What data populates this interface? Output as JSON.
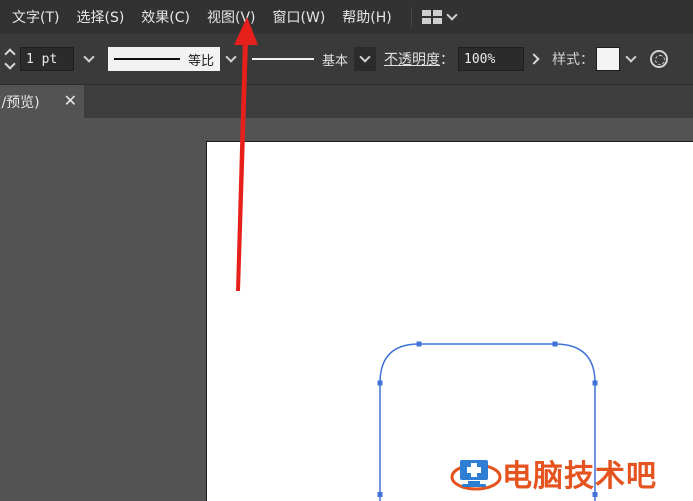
{
  "menubar": {
    "items": [
      {
        "label": "文字(T)"
      },
      {
        "label": "选择(S)"
      },
      {
        "label": "效果(C)"
      },
      {
        "label": "视图(V)"
      },
      {
        "label": "窗口(W)"
      },
      {
        "label": "帮助(H)"
      }
    ],
    "layout_icon": "workspace-layout-icon"
  },
  "controlbar": {
    "stroke_weight": "1 pt",
    "stroke_profile_label": "等比",
    "brush_label": "基本",
    "opacity_label": "不透明度",
    "opacity_colon": "：",
    "opacity_value": "100%",
    "style_label": "样式：",
    "style_swatch_color": "#f4f4f4"
  },
  "tabbar": {
    "tab_title": "(/预览)",
    "close_glyph": "✕"
  },
  "canvas": {
    "artboard_color": "#ffffff",
    "path_color": "#3f73d6",
    "annotation_arrow_color": "#e8201c"
  },
  "watermark": {
    "text": "电脑技术吧",
    "color": "#e5541f",
    "icon": "computer-plus-logo"
  }
}
